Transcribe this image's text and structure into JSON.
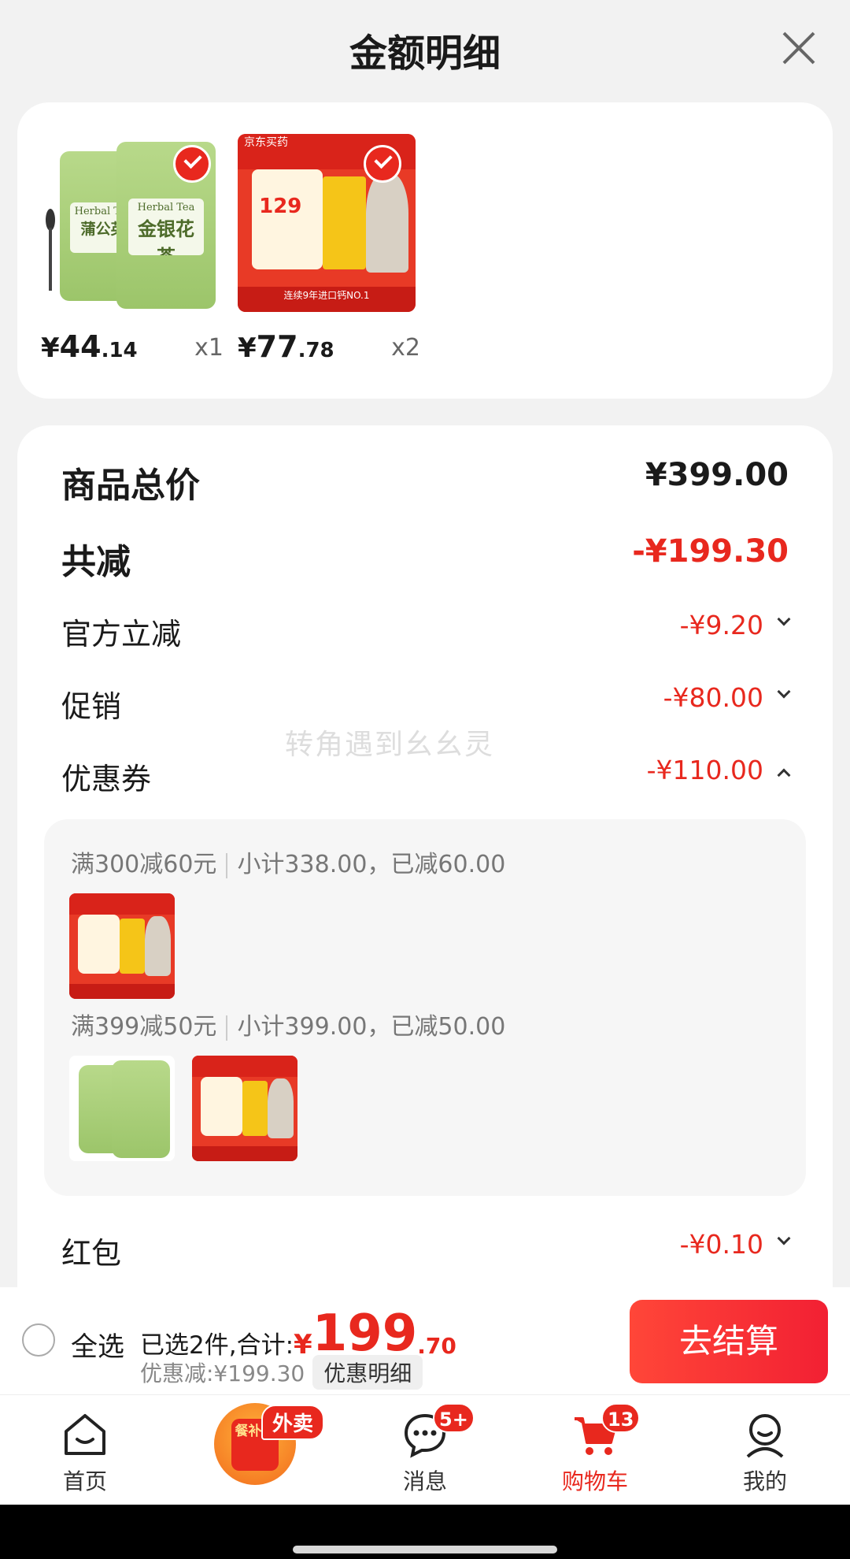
{
  "header": {
    "title": "金额明细",
    "close_icon": "close-icon"
  },
  "products": [
    {
      "image_text_en": "Herbal Tea",
      "image_text_cn_1": "蒲公英",
      "image_text_cn_2": "金银花茶",
      "price_yen": "¥",
      "price_int": "44",
      "price_dec": ".14",
      "qty": "x1",
      "selected": true
    },
    {
      "image_top": "京东买药",
      "image_num": "129",
      "image_bottom": "连续9年进口钙NO.1",
      "price_yen": "¥",
      "price_int": "77",
      "price_dec": ".78",
      "qty": "x2",
      "selected": true
    }
  ],
  "breakdown": {
    "total": {
      "label": "商品总价",
      "amount": "¥399.00"
    },
    "reduced": {
      "label": "共减",
      "amount": "-¥199.30"
    },
    "official": {
      "label": "官方立减",
      "amount": "-¥9.20"
    },
    "promo": {
      "label": "促销",
      "amount": "-¥80.00"
    },
    "coupon": {
      "label": "优惠券",
      "amount": "-¥110.00"
    },
    "redpacket": {
      "label": "红包",
      "amount": "-¥0.10"
    }
  },
  "coupons": [
    {
      "rule": "满300减60元",
      "summary": "小计338.00，已减60.00"
    },
    {
      "rule": "满399减50元",
      "summary": "小计399.00，已减50.00"
    }
  ],
  "watermark": "转角遇到幺幺灵",
  "checkout": {
    "select_all": "全选",
    "selected_prefix": "已选2件,合计:",
    "total_yen": "¥",
    "total_int": "199",
    "total_dec": ".70",
    "discount_text": "优惠减:¥199.30",
    "detail_button": "优惠明细",
    "checkout_button": "去结算"
  },
  "tabs": [
    {
      "label": "首页",
      "icon": "home-icon"
    },
    {
      "label": "",
      "icon": "meal-subsidy-icon",
      "promo_inner": "餐补券",
      "promo_tag": "外卖"
    },
    {
      "label": "消息",
      "icon": "message-icon",
      "badge": "5+"
    },
    {
      "label": "购物车",
      "icon": "cart-icon",
      "badge": "13",
      "active": true
    },
    {
      "label": "我的",
      "icon": "user-icon"
    }
  ],
  "colors": {
    "accent": "#e8281e",
    "background": "#f2f2f2"
  }
}
